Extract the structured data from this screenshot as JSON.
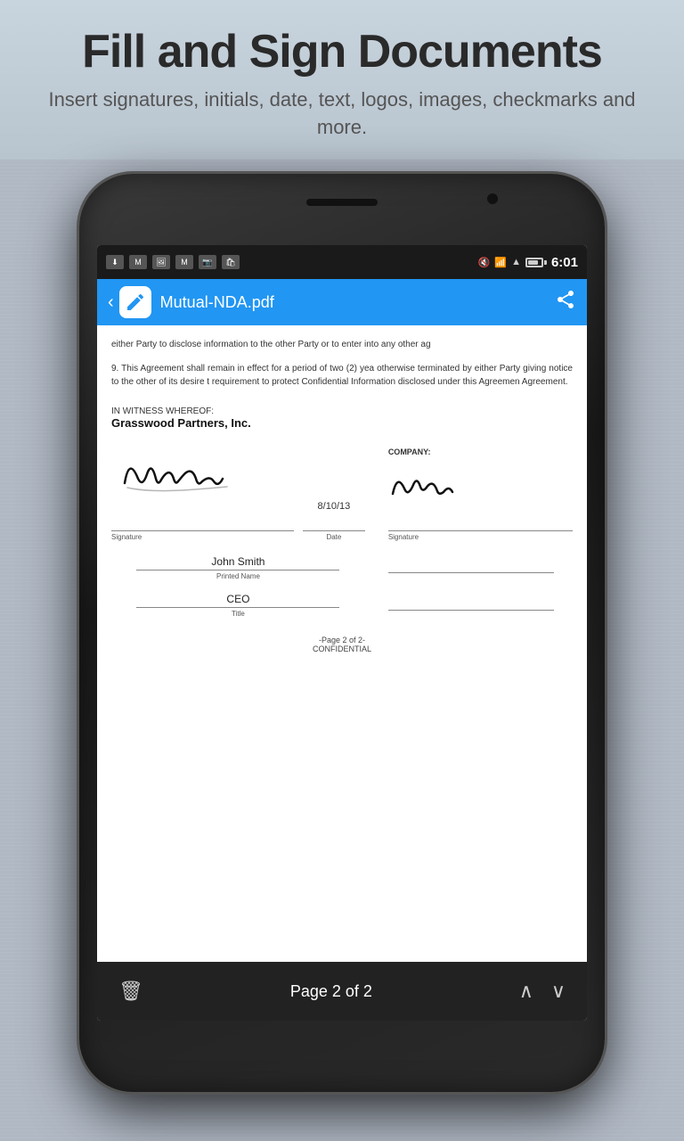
{
  "header": {
    "title": "Fill and Sign Documents",
    "subtitle": "Insert signatures, initials, date, text, logos, images, checkmarks and more."
  },
  "statusbar": {
    "time": "6:01"
  },
  "toolbar": {
    "filename": "Mutual-NDA.pdf"
  },
  "document": {
    "paragraph1": "either Party to disclose information to the other Party or to enter into any other ag",
    "paragraph2": "9.       This Agreement shall remain in effect for a period of two (2) yea otherwise terminated by either Party giving notice to the other of its desire t requirement to protect Confidential Information disclosed under this Agreemen Agreement.",
    "witness_header": "IN WITNESS WHEREOF:",
    "company_name": "Grasswood Partners, Inc.",
    "company_label": "COMPANY:",
    "sig_left_label": "Signature",
    "date_label": "Date",
    "date_value": "8/10/13",
    "sig_right_label": "Signature",
    "printed_name": "John Smith",
    "printed_name_label": "Printed Name",
    "title_value": "CEO",
    "title_label": "Title",
    "page_footer_line1": "-Page 2 of 2-",
    "page_footer_line2": "CONFIDENTIAL"
  },
  "bottomnav": {
    "page_info": "Page 2 of 2",
    "trash_icon": "🗑",
    "up_icon": "∧",
    "down_icon": "∨"
  }
}
